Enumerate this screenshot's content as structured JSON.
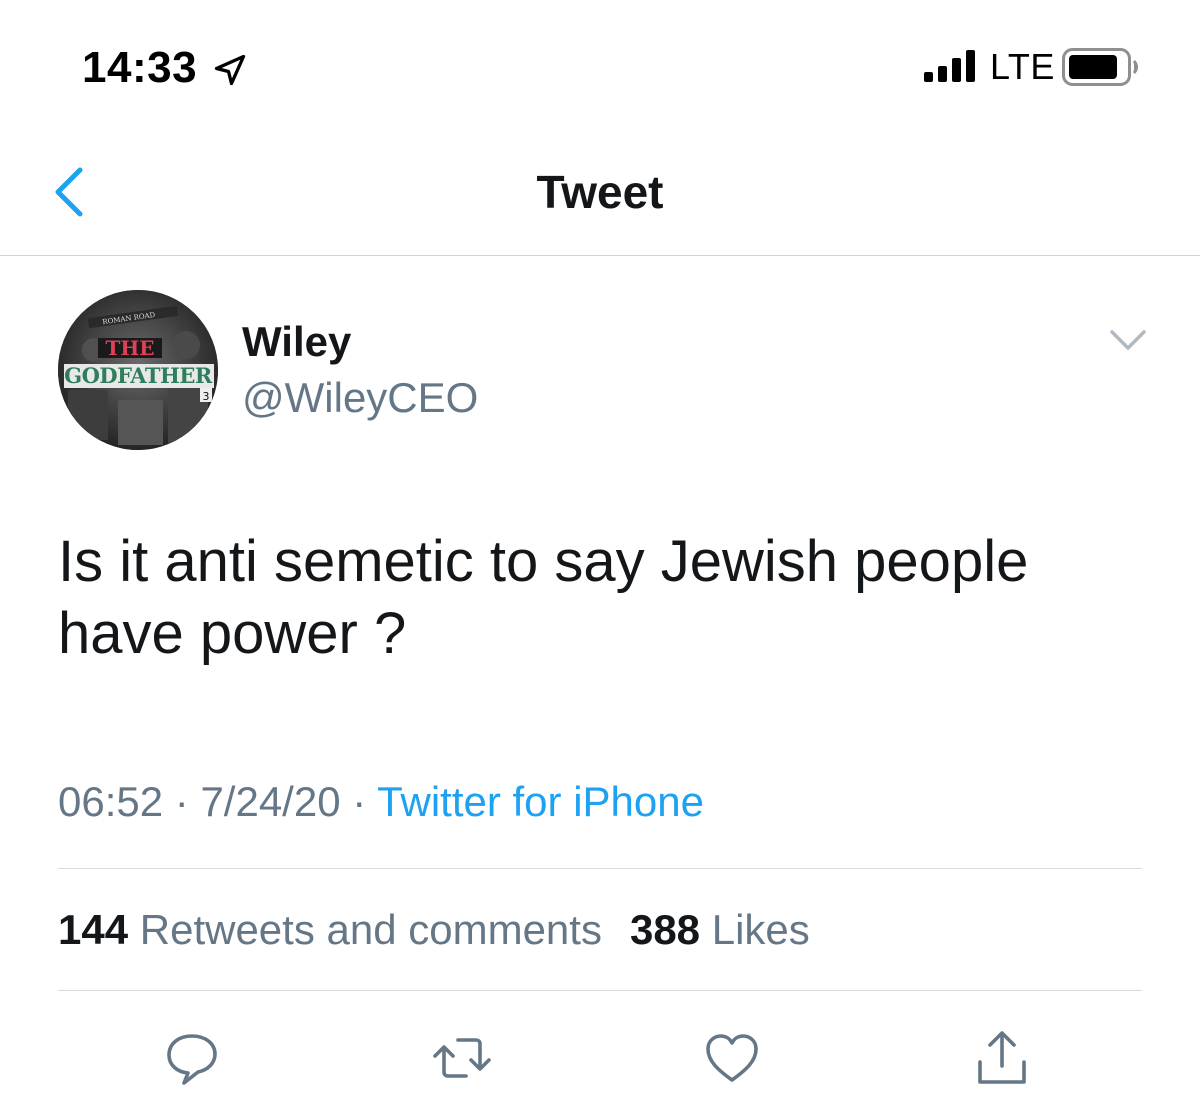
{
  "status_bar": {
    "time": "14:33",
    "network": "LTE",
    "icons": [
      "location-arrow-icon",
      "signal-icon",
      "battery-icon"
    ]
  },
  "nav": {
    "title": "Tweet",
    "back_icon": "chevron-left-icon"
  },
  "tweet": {
    "author": {
      "display_name": "Wiley",
      "handle": "@WileyCEO",
      "avatar_text": {
        "top": "ROMAN ROAD",
        "title_line1": "THE",
        "title_line2": "GODFATHER",
        "number": "3"
      }
    },
    "text_line1": "Is it anti semetic to say Jewish people",
    "text_line2": "have power ?",
    "time": "06:52",
    "date": "7/24/20",
    "separator": " · ",
    "source": "Twitter for iPhone",
    "stats": {
      "retweets_count": "144",
      "retweets_label": "Retweets and comments",
      "likes_count": "388",
      "likes_label": "Likes"
    }
  },
  "actions": [
    {
      "icon": "reply-icon"
    },
    {
      "icon": "retweet-icon"
    },
    {
      "icon": "like-heart-icon"
    },
    {
      "icon": "share-icon"
    }
  ],
  "colors": {
    "accent": "#1da1f2",
    "text_primary": "#14171a",
    "text_secondary": "#657786",
    "divider": "#d6dbdf"
  }
}
